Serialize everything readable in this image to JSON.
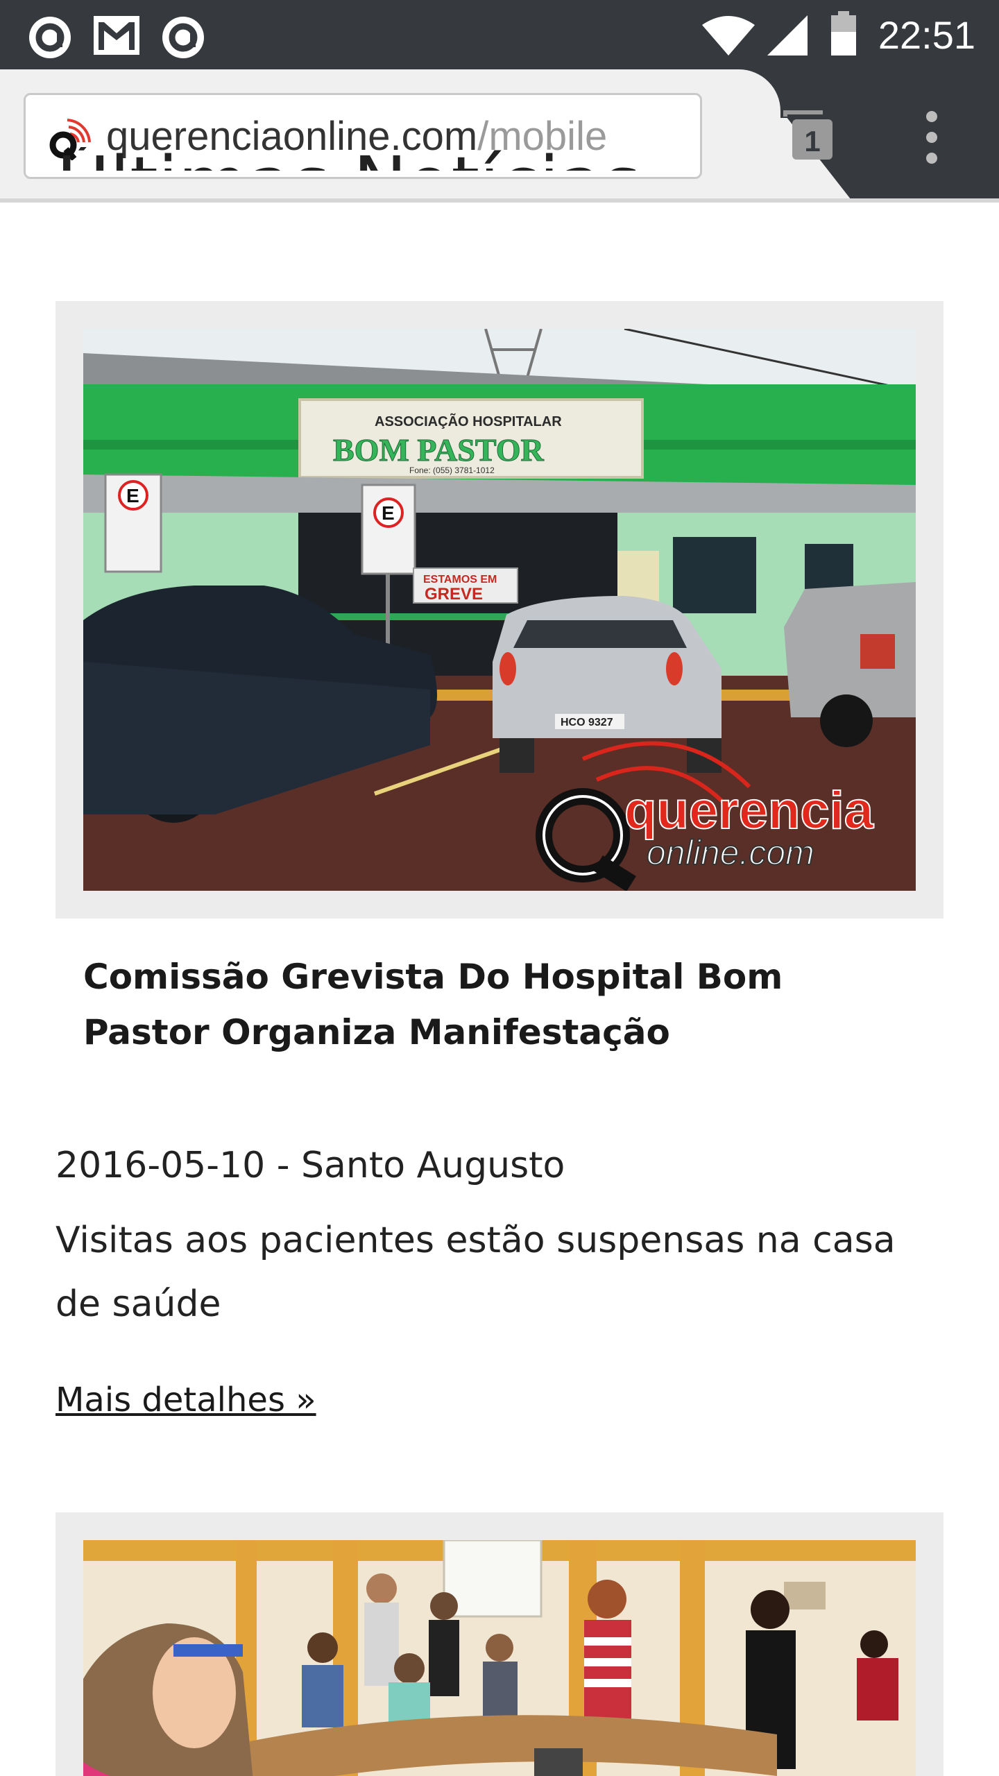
{
  "status_bar": {
    "time": "22:51",
    "icons": [
      "app-notification-icon",
      "gmail-icon",
      "app-notification-icon",
      "wifi-icon",
      "cell-signal-icon",
      "battery-icon"
    ]
  },
  "browser": {
    "url_host": "querenciaonline.com",
    "url_path": "/mobile",
    "tab_count": "1"
  },
  "page": {
    "section_title": "Últimas Notícias:",
    "articles": [
      {
        "image_description": "hospital-building-photo",
        "image_text": {
          "sign_top": "ASSOCIAÇÃO HOSPITALAR",
          "sign_main": "BOM PASTOR",
          "sign_phone": "Fone: (055) 3781-1012",
          "strike_sign_1": "ESTAMOS EM",
          "strike_sign_2": "GREVE",
          "watermark_1": "querencia",
          "watermark_2": "online.com",
          "plate": "HCO 9327"
        },
        "title": "Comissão Grevista Do Hospital Bom Pastor Organiza Manifestação",
        "meta": "2016-05-10 - Santo Augusto",
        "summary": "Visitas aos pacientes estão suspensas na casa de saúde",
        "link": "Mais detalhes »"
      }
    ]
  },
  "colors": {
    "status_bar_bg": "#363a3e",
    "toolbar_bg": "#f0f0f0",
    "card_bg": "#ececec",
    "brand_red": "#d9261c"
  }
}
